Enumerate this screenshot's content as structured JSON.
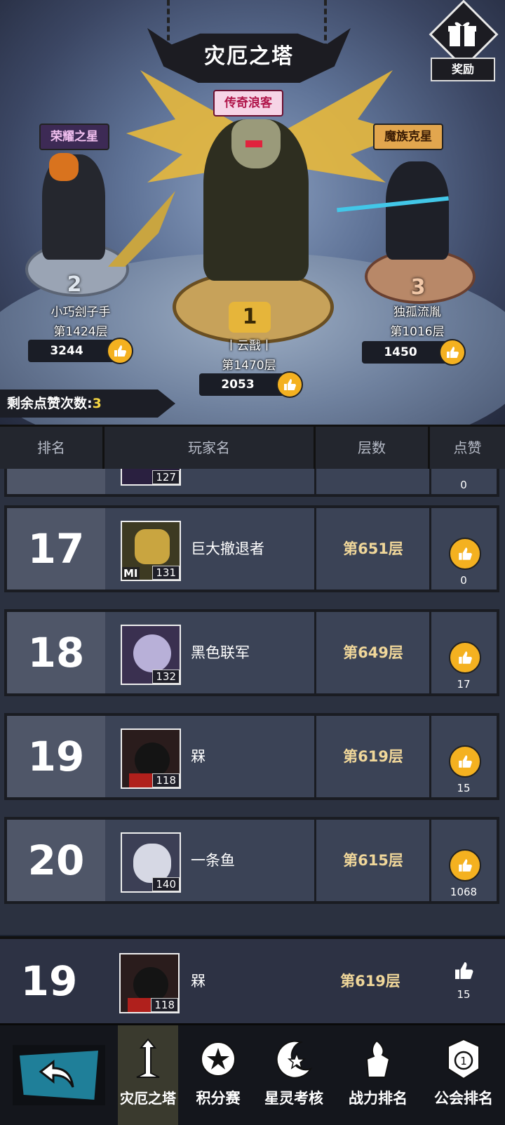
{
  "header": {
    "title": "灾厄之塔",
    "reward_label": "奖励"
  },
  "podium": {
    "first": {
      "title_badge": "传奇浪客",
      "rank": "1",
      "name": "丨云戬丨",
      "floor": "第1470层",
      "likes": "2053"
    },
    "second": {
      "title_badge": "荣耀之星",
      "rank": "2",
      "name": "小巧刽子手",
      "floor": "第1424层",
      "likes": "3244"
    },
    "third": {
      "title_badge": "魔族克星",
      "rank": "3",
      "name": "独孤流胤",
      "floor": "第1016层",
      "likes": "1450"
    }
  },
  "remaining_likes": {
    "label": "剩余点赞次数:",
    "count": "3"
  },
  "table_header": {
    "rank": "排名",
    "player": "玩家名",
    "floor": "层数",
    "likes": "点赞"
  },
  "partial_row": {
    "level": "127",
    "likes": "0"
  },
  "rows": [
    {
      "rank": "17",
      "name": "巨大撤退者",
      "level": "131",
      "badge": "MI",
      "floor": "第651层",
      "likes": "0"
    },
    {
      "rank": "18",
      "name": "黑色联军",
      "level": "132",
      "floor": "第649层",
      "likes": "17"
    },
    {
      "rank": "19",
      "name": "槑",
      "level": "118",
      "floor": "第619层",
      "likes": "15"
    },
    {
      "rank": "20",
      "name": "一条鱼",
      "level": "140",
      "floor": "第615层",
      "likes": "1068"
    }
  ],
  "my_row": {
    "rank": "19",
    "name": "槑",
    "level": "118",
    "floor": "第619层",
    "likes": "15"
  },
  "nav": {
    "items": [
      {
        "label": "灾厄之塔",
        "icon": "tower-icon"
      },
      {
        "label": "积分赛",
        "icon": "star-shield-icon"
      },
      {
        "label": "星灵考核",
        "icon": "moon-star-icon"
      },
      {
        "label": "战力排名",
        "icon": "fist-icon"
      },
      {
        "label": "公会排名",
        "icon": "guild-badge-icon"
      }
    ]
  },
  "colors": {
    "accent_gold": "#f4b120",
    "remain_count": "#f6d743",
    "floor_text": "#f0d79a"
  }
}
